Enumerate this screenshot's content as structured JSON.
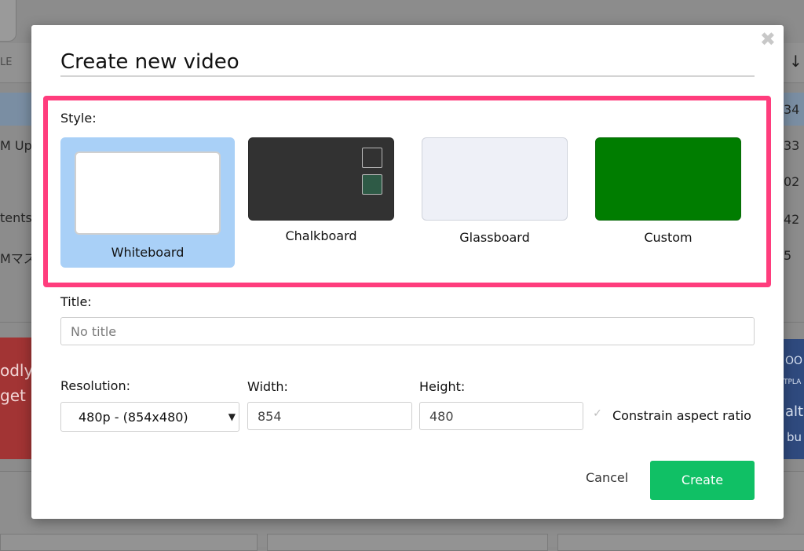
{
  "background": {
    "header_partial": "LE",
    "rows": [
      "M Up",
      "tents",
      "Mマス"
    ],
    "numbers": [
      "34",
      "33",
      "02",
      "42",
      "5"
    ],
    "card_left": [
      "odly",
      "get"
    ],
    "card_right": [
      "OO",
      "TPLA",
      "alt",
      "bu"
    ]
  },
  "modal": {
    "title": "Create new video",
    "close_glyph": "✖",
    "style_label": "Style:",
    "styles": [
      {
        "label": "Whiteboard",
        "selected": true,
        "color": "#ffffff"
      },
      {
        "label": "Chalkboard",
        "selected": false,
        "color": "#323232"
      },
      {
        "label": "Glassboard",
        "selected": false,
        "color": "#eef0f7"
      },
      {
        "label": "Custom",
        "selected": false,
        "color": "#007d00"
      }
    ],
    "title_label": "Title:",
    "title_placeholder": "No title",
    "resolution_label": "Resolution:",
    "resolution_value": "480p  -  (854x480)",
    "width_label": "Width:",
    "width_value": "854",
    "height_label": "Height:",
    "height_value": "480",
    "constrain_label": "Constrain aspect ratio",
    "constrain_checked": true,
    "cancel_label": "Cancel",
    "create_label": "Create",
    "highlight_color": "#ff3d7d",
    "accent_color": "#10c065"
  }
}
